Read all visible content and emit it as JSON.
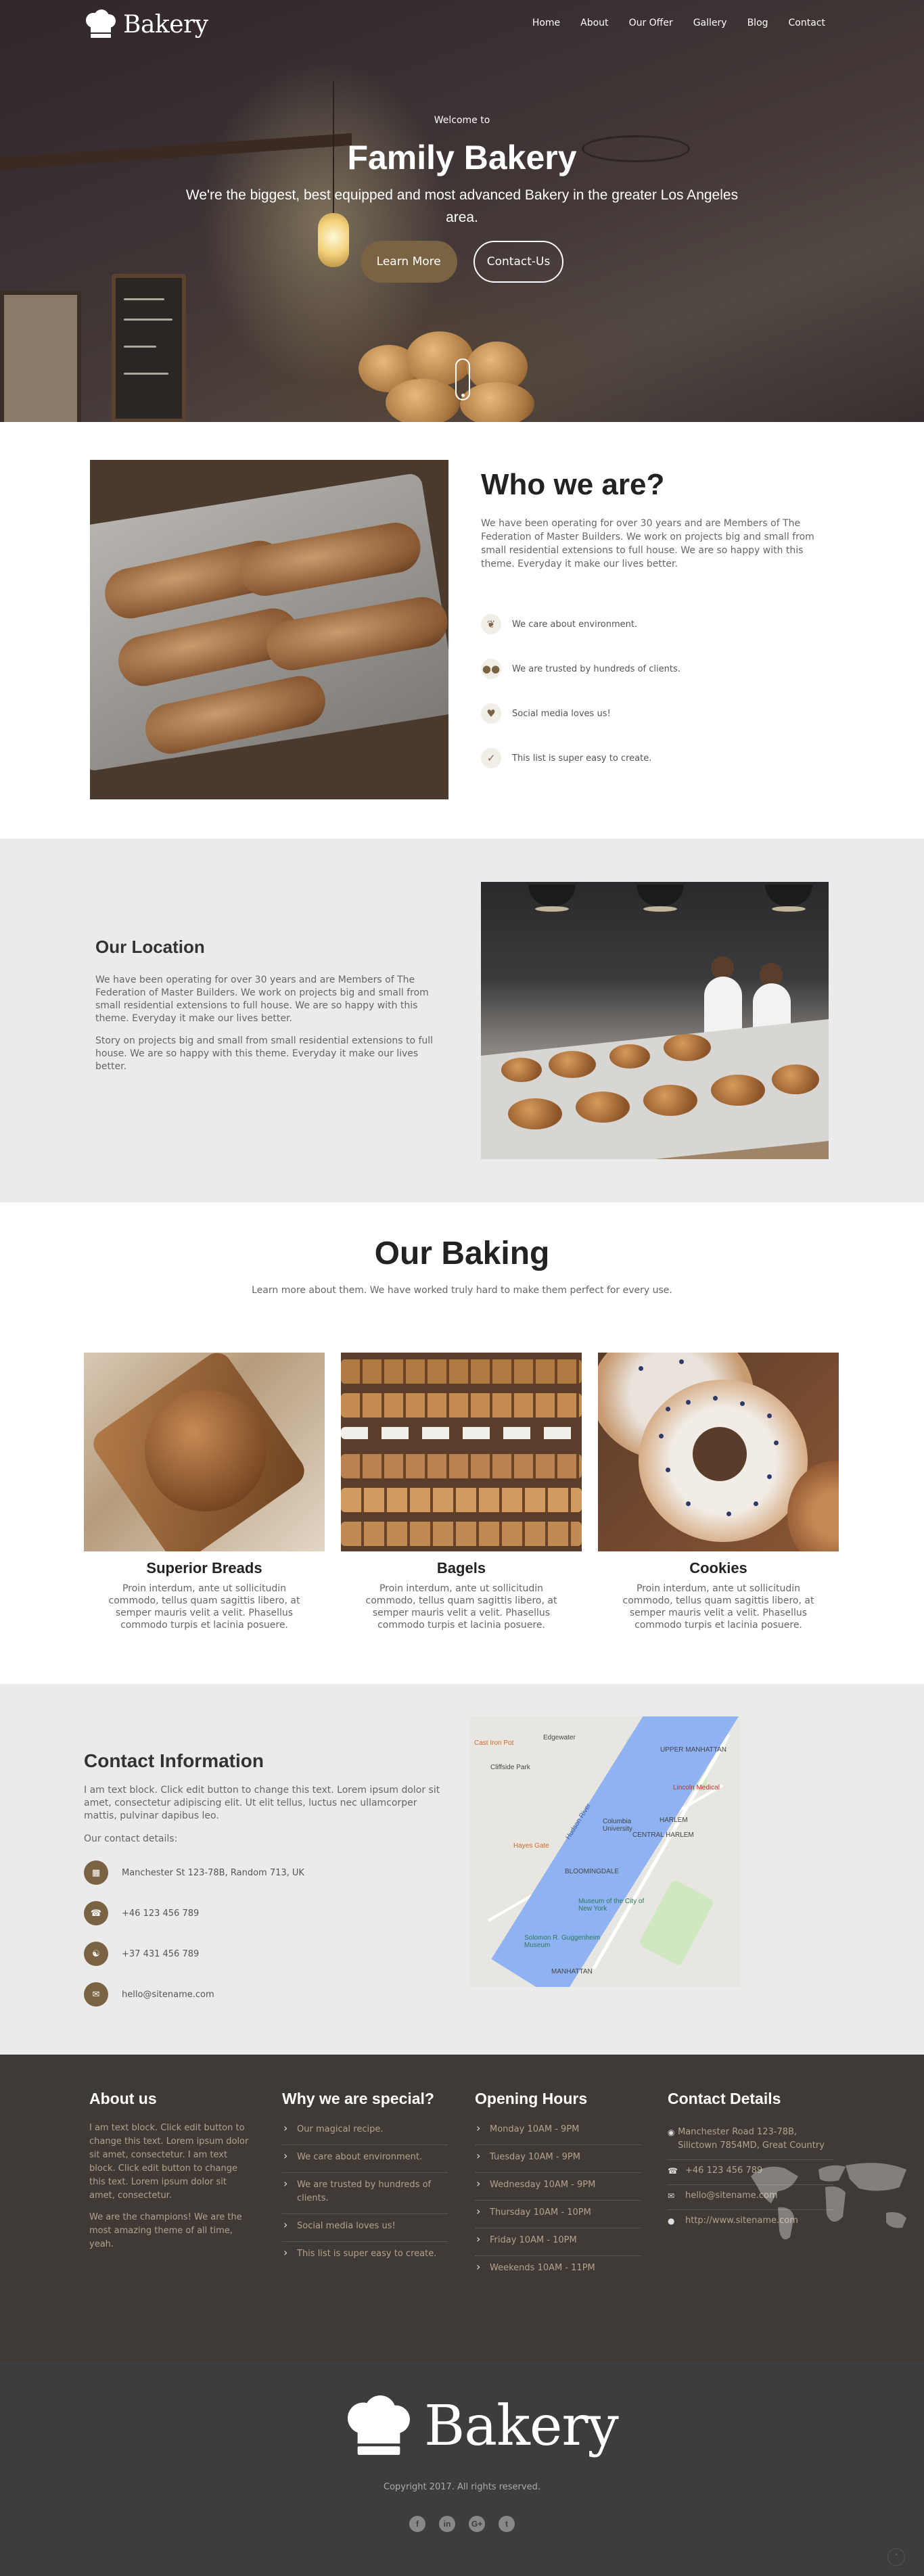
{
  "brand": {
    "name": "Bakery",
    "accent": "#7a6342"
  },
  "nav": {
    "items": [
      "Home",
      "About",
      "Our Offer",
      "Gallery",
      "Blog",
      "Contact"
    ]
  },
  "hero": {
    "welcome": "Welcome to",
    "title": "Family Bakery",
    "subtitle": "We're the biggest, best equipped and most advanced Bakery in the greater Los Angeles area.",
    "primary_button": "Learn More",
    "secondary_button": "Contact-Us"
  },
  "who": {
    "title": "Who we are?",
    "body": "We have been operating for over 30 years and are Members of The Federation of Master Builders. We work on projects big and small from small residential extensions to full house. We are so happy with this theme. Everyday it make our lives better.",
    "features": [
      {
        "icon": "leaf-icon",
        "text": "We care about environment."
      },
      {
        "icon": "users-icon",
        "text": "We are trusted by hundreds of clients."
      },
      {
        "icon": "heart-icon",
        "text": "Social media loves us!"
      },
      {
        "icon": "check-icon",
        "text": "This list is super easy to create."
      }
    ]
  },
  "location": {
    "title": "Our Location",
    "paragraph1": "We have been operating for over 30 years and are Members of The Federation of Master Builders. We work on projects big and small from small residential extensions to full house. We are so happy with this theme. Everyday it make our lives better.",
    "paragraph2": "Story on projects big and small from small residential extensions to full house. We are so happy with this theme. Everyday it make our lives better."
  },
  "baking": {
    "title": "Our Baking",
    "subtitle": "Learn more about them. We have worked truly hard to make them perfect for every use.",
    "cards": [
      {
        "title": "Superior Breads",
        "body": "Proin interdum, ante ut sollicitudin commodo, tellus quam sagittis libero, at semper mauris velit a velit. Phasellus commodo turpis et lacinia posuere."
      },
      {
        "title": "Bagels",
        "body": "Proin interdum, ante ut sollicitudin commodo, tellus quam sagittis libero, at semper mauris velit a velit. Phasellus commodo turpis et lacinia posuere."
      },
      {
        "title": "Cookies",
        "body": "Proin interdum, ante ut sollicitudin commodo, tellus quam sagittis libero, at semper mauris velit a velit. Phasellus commodo turpis et lacinia posuere."
      }
    ]
  },
  "contact": {
    "title": "Contact Information",
    "body": "I am text block. Click edit button to change this text. Lorem ipsum dolor sit amet, consectetur adipiscing elit. Ut elit tellus, luctus nec ullamcorper mattis, pulvinar dapibus leo.",
    "details_label": "Our contact details:",
    "items": [
      {
        "icon": "map-icon",
        "text": "Manchester St 123-78B, Random 713, UK"
      },
      {
        "icon": "phone-icon",
        "text": "+46 123 456 789"
      },
      {
        "icon": "headset-icon",
        "text": "+37 431 456 789"
      },
      {
        "icon": "mail-icon",
        "text": "hello@sitename.com"
      }
    ],
    "map_labels": [
      "Cast Iron Pot",
      "Edgewater",
      "Cliffside Park",
      "UPPER MANHATTAN",
      "Lincoln Medical",
      "HARLEM",
      "CENTRAL HARLEM",
      "Columbia University",
      "BLOOMINGDALE",
      "Museum of the City of New York",
      "Solomon R. Guggenheim Museum",
      "MANHATTAN",
      "Hayes Gate",
      "Hudson River"
    ]
  },
  "footer": {
    "about": {
      "title": "About us",
      "text1": "I am text block. Click edit button to change this text. Lorem ipsum dolor sit amet, consectetur. I am text block. Click edit button to change this text. Lorem ipsum dolor sit amet, consectetur.",
      "text2": "We are the champions! We are the most amazing theme of all time, yeah."
    },
    "special": {
      "title": "Why we are special?",
      "items": [
        "Our magical recipe.",
        "We care about environment.",
        "We are trusted by hundreds of clients.",
        "Social media loves us!",
        "This list is super easy to create."
      ]
    },
    "hours": {
      "title": "Opening Hours",
      "items": [
        "Monday 10AM - 9PM",
        "Tuesday 10AM - 9PM",
        "Wednesday 10AM - 9PM",
        "Thursday 10AM - 10PM",
        "Friday 10AM - 10PM",
        "Weekends 10AM - 11PM"
      ]
    },
    "details": {
      "title": "Contact Details",
      "items": [
        {
          "icon": "pin-icon",
          "text": "Manchester Road 123-78B, Silictown 7854MD, Great Country"
        },
        {
          "icon": "phone-icon",
          "text": "+46 123 456 789"
        },
        {
          "icon": "mail-icon",
          "text": "hello@sitename.com"
        },
        {
          "icon": "globe-icon",
          "text": "http://www.sitename.com"
        }
      ]
    },
    "copyright": "Copyright 2017. All rights reserved.",
    "socials": [
      "facebook-icon",
      "linkedin-icon",
      "google-plus-icon",
      "twitter-icon"
    ]
  }
}
